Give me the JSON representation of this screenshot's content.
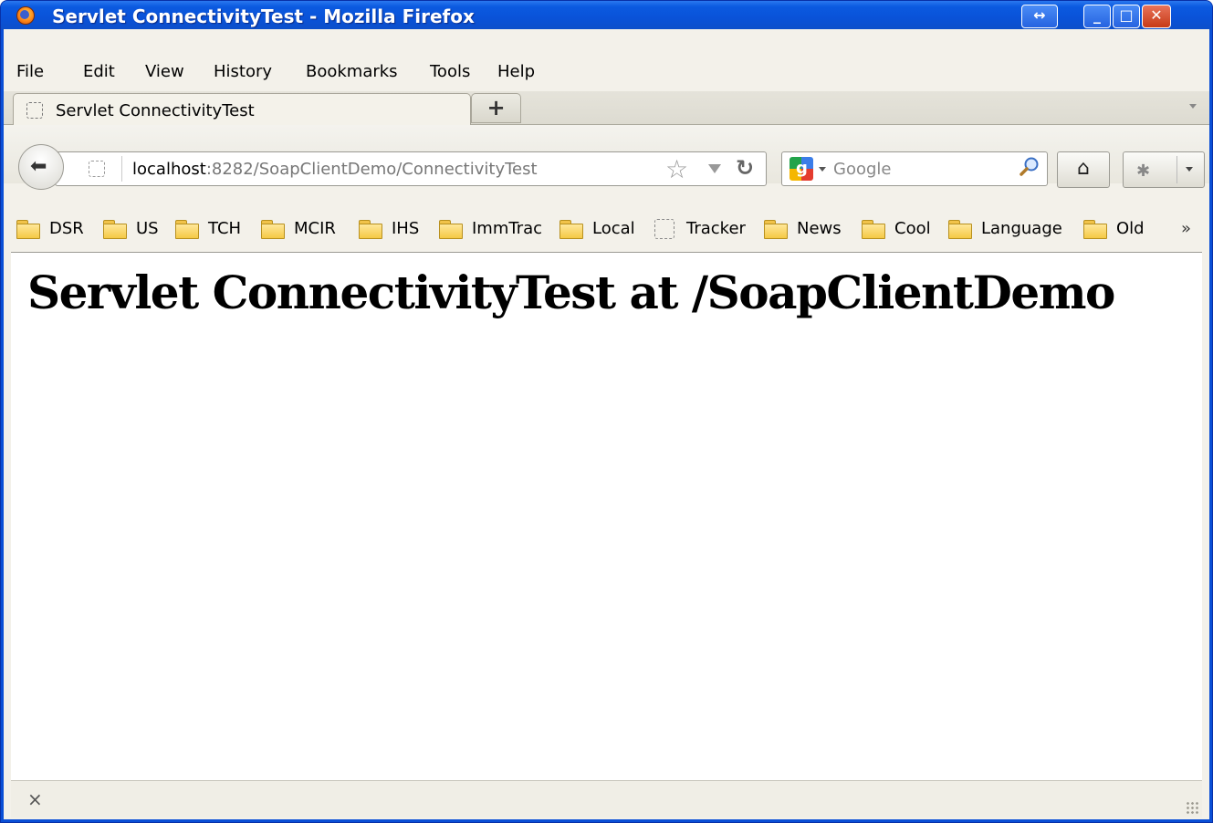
{
  "window": {
    "title": "Servlet ConnectivityTest - Mozilla Firefox"
  },
  "menubar": {
    "items": [
      "File",
      "Edit",
      "View",
      "History",
      "Bookmarks",
      "Tools",
      "Help"
    ]
  },
  "tabs": [
    {
      "title": "Servlet ConnectivityTest"
    }
  ],
  "newtab": {
    "label": "+"
  },
  "urlbar": {
    "host": "localhost",
    "path": ":8282/SoapClientDemo/ConnectivityTest"
  },
  "searchbar": {
    "placeholder": "Google",
    "engine_letter": "g"
  },
  "bookmarks": [
    {
      "label": "DSR",
      "type": "folder"
    },
    {
      "label": "US",
      "type": "folder"
    },
    {
      "label": "TCH",
      "type": "folder"
    },
    {
      "label": "MCIR",
      "type": "folder"
    },
    {
      "label": "IHS",
      "type": "folder"
    },
    {
      "label": "ImmTrac",
      "type": "folder"
    },
    {
      "label": "Local",
      "type": "folder"
    },
    {
      "label": "Tracker",
      "type": "page"
    },
    {
      "label": "News",
      "type": "folder"
    },
    {
      "label": "Cool",
      "type": "folder"
    },
    {
      "label": "Language",
      "type": "folder"
    },
    {
      "label": "Old",
      "type": "folder"
    }
  ],
  "bookmarks_overflow": "»",
  "page": {
    "heading": "Servlet ConnectivityTest at /SoapClientDemo"
  },
  "statusbar": {
    "close_glyph": "×"
  },
  "colors": {
    "titlebar": "#0a52d8",
    "chrome": "#f3f1ea",
    "close_button": "#c73a17"
  }
}
